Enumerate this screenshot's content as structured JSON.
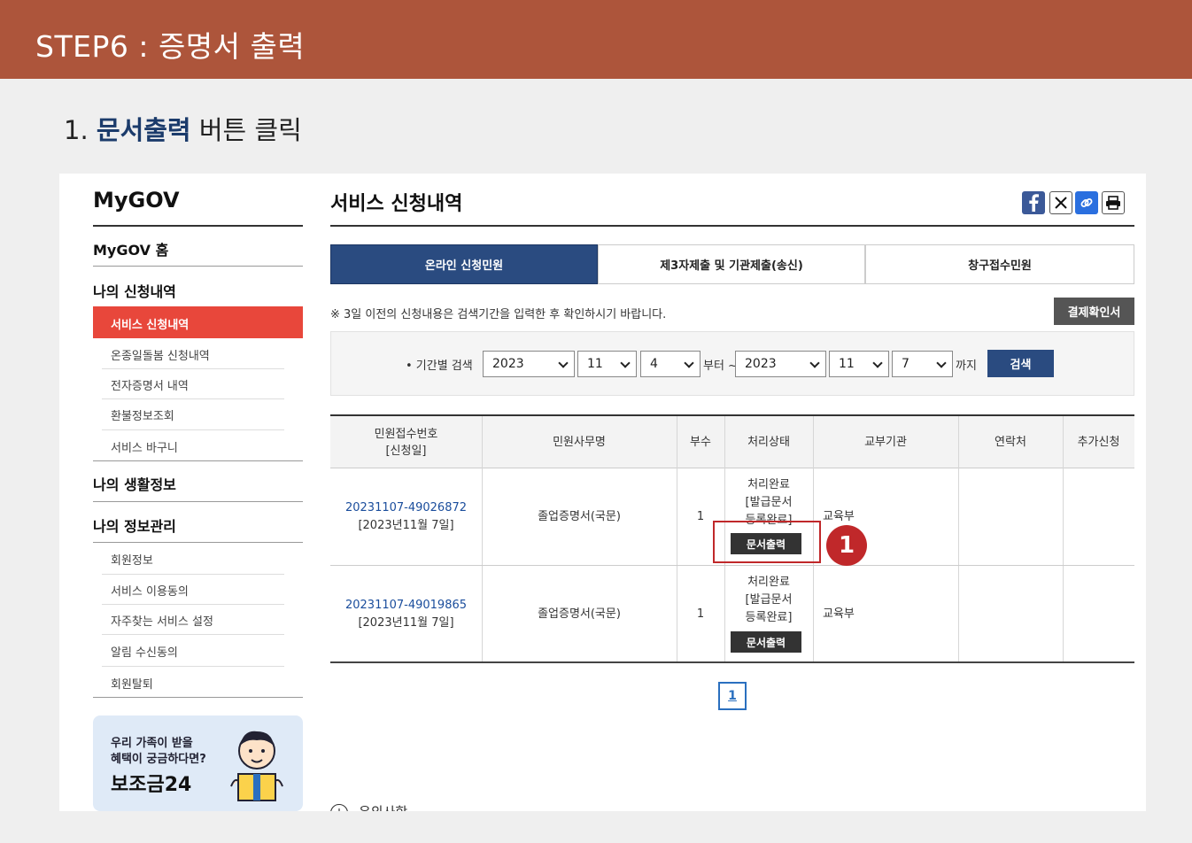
{
  "banner": {
    "title": "STEP6 : 증명서 출력"
  },
  "instruction": {
    "prefix": "1. ",
    "bold": "문서출력",
    "suffix": " 버튼 클릭"
  },
  "sidebar": {
    "title": "MyGOV",
    "home": "MyGOV 홈",
    "section_apply": "나의 신청내역",
    "active_item": "서비스 신청내역",
    "apply_items": [
      "온종일돌봄 신청내역",
      "전자증명서 내역",
      "환불정보조회",
      "서비스 바구니"
    ],
    "section_life": "나의 생활정보",
    "section_info": "나의 정보관리",
    "info_items": [
      "회원정보",
      "서비스 이용동의",
      "자주찾는 서비스 설정",
      "알림 수신동의",
      "회원탈퇴"
    ],
    "promo": {
      "line1": "우리 가족이 받을",
      "line2": "혜택이 궁금하다면?",
      "big": "보조금24"
    }
  },
  "main": {
    "title": "서비스 신청내역",
    "share_icons": [
      "facebook-icon",
      "x-icon",
      "link-icon",
      "print-icon"
    ],
    "tabs": [
      "온라인 신청민원",
      "제3자제출 및 기관제출(송신)",
      "창구접수민원"
    ],
    "notice": "※ 3일 이전의 신청내용은 검색기간을 입력한 후 확인하시기 바랍니다.",
    "receipt_button": "결제확인서",
    "search": {
      "label": "• 기간별 검색",
      "from": {
        "year": "2023",
        "month": "11",
        "day": "4"
      },
      "from_suffix": "부터 ~",
      "to": {
        "year": "2023",
        "month": "11",
        "day": "7"
      },
      "to_suffix": "까지",
      "button": "검색"
    },
    "table": {
      "headers": {
        "number_l1": "민원접수번호",
        "number_l2": "[신청일]",
        "name": "민원사무명",
        "copies": "부수",
        "status": "처리상태",
        "agency": "교부기관",
        "contact": "연락처",
        "extra": "추가신청"
      },
      "rows": [
        {
          "number": "20231107-49026872",
          "date": "[2023년11월 7일]",
          "name": "졸업증명서(국문)",
          "copies": "1",
          "status_l1": "처리완료",
          "status_l2": "[발급문서",
          "status_l3": "등록완료]",
          "print_label": "문서출력",
          "agency": "교육부"
        },
        {
          "number": "20231107-49019865",
          "date": "[2023년11월 7일]",
          "name": "졸업증명서(국문)",
          "copies": "1",
          "status_l1": "처리완료",
          "status_l2": "[발급문서",
          "status_l3": "등록완료]",
          "print_label": "문서출력",
          "agency": "교육부"
        }
      ]
    },
    "marker": "1",
    "pagination": {
      "current": "1"
    },
    "caution": "유의사항"
  },
  "colors": {
    "banner": "#ad553b",
    "active_tab": "#2a4b80",
    "active_menu": "#e8473b",
    "highlight": "#c0282a"
  }
}
